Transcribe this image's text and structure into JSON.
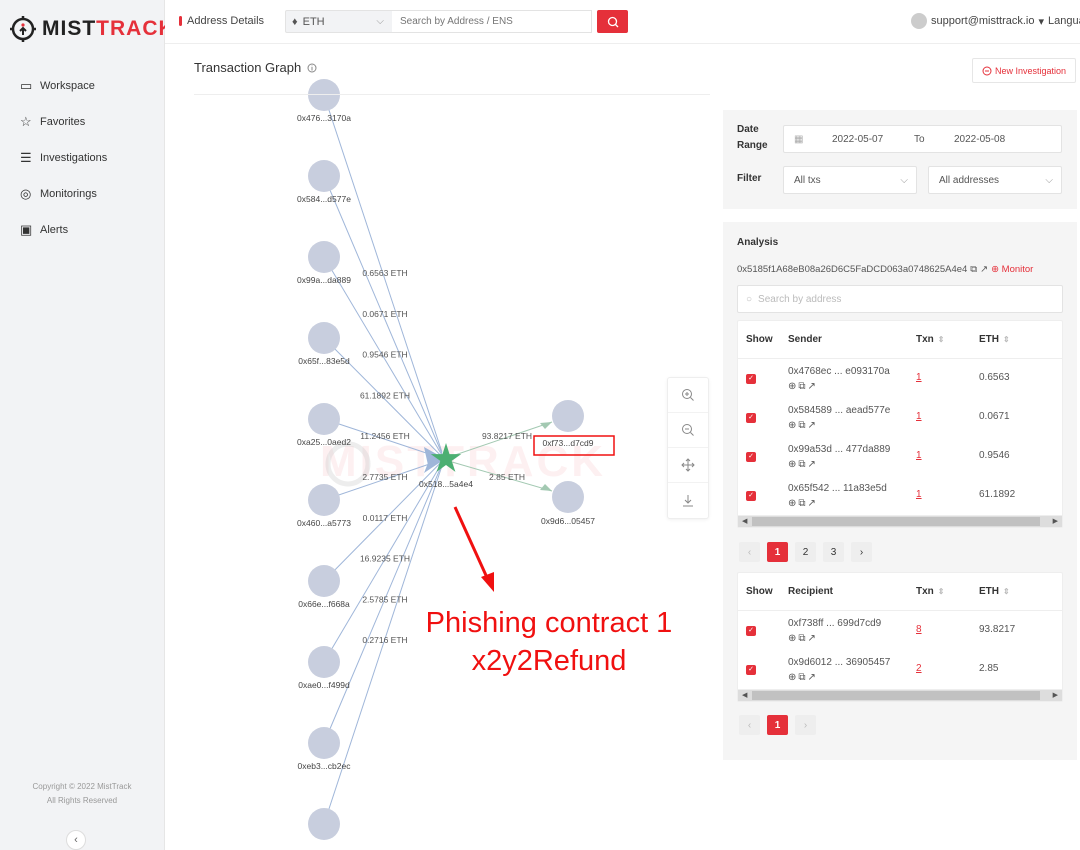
{
  "brand": {
    "name_a": "MIST",
    "name_b": "TRACK",
    "accent": "#e5303a"
  },
  "sidebar": {
    "items": [
      {
        "label": "Workspace",
        "icon": "monitor-icon"
      },
      {
        "label": "Favorites",
        "icon": "star-icon"
      },
      {
        "label": "Investigations",
        "icon": "list-icon"
      },
      {
        "label": "Monitorings",
        "icon": "target-icon"
      },
      {
        "label": "Alerts",
        "icon": "image-icon"
      }
    ],
    "copyright": "Copyright © 2022 MistTrack",
    "rights": "All Rights Reserved"
  },
  "topbar": {
    "breadcrumb": "Address Details",
    "chain": "ETH",
    "search_placeholder": "Search by Address / ENS",
    "user": "support@misttrack.io",
    "language": "Langua"
  },
  "main": {
    "title": "Transaction Graph",
    "new_investigation": "New Investigation"
  },
  "graph": {
    "center": "0x518...5a4e4",
    "senders": [
      {
        "label": "0x476...3170a"
      },
      {
        "label": "0x584...d577e"
      },
      {
        "label": "0x99a...da889"
      },
      {
        "label": "0x65f...83e5d"
      },
      {
        "label": "0xa25...0aed2"
      },
      {
        "label": "0x460...a5773"
      },
      {
        "label": "0x66e...f668a"
      },
      {
        "label": "0xae0...f499d"
      },
      {
        "label": "0xeb3...cb2ec"
      },
      {
        "label": ""
      }
    ],
    "extra_top": true,
    "edge_labels": [
      "0.6563 ETH",
      "0.0671 ETH",
      "0.9546 ETH",
      "61.1892 ETH",
      "11.2456 ETH",
      "2.7735 ETH",
      "0.0117 ETH",
      "16.9235 ETH",
      "2.5785 ETH",
      "0.2716 ETH"
    ],
    "recipients": [
      {
        "label": "0xf73...d7cd9",
        "amount": "93.8217 ETH",
        "highlighted": true
      },
      {
        "label": "0x9d6...05457",
        "amount": "2.85 ETH"
      }
    ],
    "colors": {
      "node": "#c8cede",
      "in_edge": "#9fb6d9",
      "out_edge": "#a3c9b2",
      "center": "#4caf72"
    }
  },
  "annotation": {
    "line1": "Phishing contract 1",
    "line2": "x2y2Refund",
    "color": "#f01010"
  },
  "filters": {
    "date_label": "Date Range",
    "from": "2022-05-07",
    "to_label": "To",
    "to": "2022-05-08",
    "filter_label": "Filter",
    "tx_filter": "All txs",
    "addr_filter": "All addresses"
  },
  "analysis": {
    "title": "Analysis",
    "address": "0x5185f1A68eB08a26D6C5FaDCD063a0748625A4e4",
    "monitor": "Monitor",
    "search_placeholder": "Search by address",
    "sender_table": {
      "headers": [
        "Show",
        "Sender",
        "Txn",
        "ETH"
      ],
      "rows": [
        {
          "address": "0x4768ec ... e093170a",
          "txn": "1",
          "eth": "0.6563",
          "checked": true
        },
        {
          "address": "0x584589 ... aead577e",
          "txn": "1",
          "eth": "0.0671",
          "checked": true
        },
        {
          "address": "0x99a53d ... 477da889",
          "txn": "1",
          "eth": "0.9546",
          "checked": true
        },
        {
          "address": "0x65f542 ... 11a83e5d",
          "txn": "1",
          "eth": "61.1892",
          "checked": true
        }
      ]
    },
    "sender_pages": [
      "1",
      "2",
      "3"
    ],
    "sender_current_page": "1",
    "recipient_table": {
      "headers": [
        "Show",
        "Recipient",
        "Txn",
        "ETH"
      ],
      "rows": [
        {
          "address": "0xf738ff ... 699d7cd9",
          "txn": "8",
          "eth": "93.8217",
          "checked": true
        },
        {
          "address": "0x9d6012 ... 36905457",
          "txn": "2",
          "eth": "2.85",
          "checked": true
        }
      ]
    },
    "recipient_pages": [
      "1"
    ],
    "recipient_current_page": "1"
  }
}
